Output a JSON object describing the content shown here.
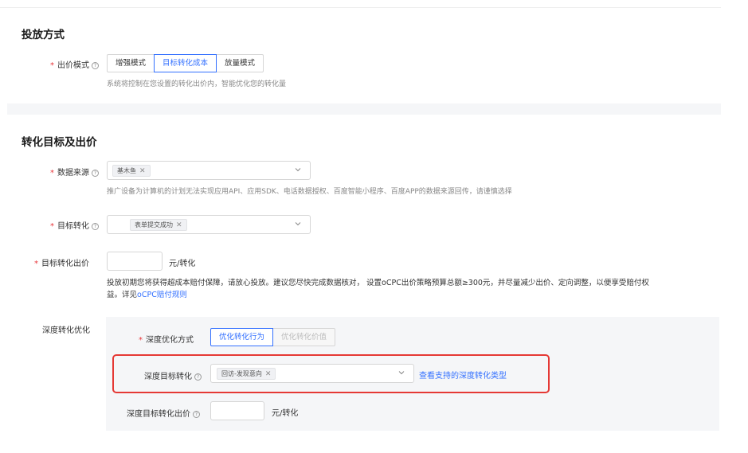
{
  "section1": {
    "title": "投放方式",
    "bid_mode_label": "出价模式",
    "modes": [
      "增强模式",
      "目标转化成本",
      "放量模式"
    ],
    "active_mode": "目标转化成本",
    "hint": "系统将控制在您设置的转化出价内，智能优化您的转化量"
  },
  "section2": {
    "title": "转化目标及出价",
    "data_source_label": "数据来源",
    "data_source_tag": "基木鱼",
    "data_source_hint": "推广设备为计算机的计划无法实现应用API、应用SDK、电话数据授权、百度智能小程序、百度APP的数据来源回传，请谨慎选择",
    "target_conv_label": "目标转化",
    "target_conv_tag": "表单提交成功",
    "target_bid_label": "目标转化出价",
    "target_bid_value": "",
    "target_bid_unit": "元/转化",
    "notice_line1": "投放初期您将获得超成本赔付保障，请放心投放。建议您尽快完成数据核对， 设置oCPC出价策略预算总额≥300元，并尽量减少出价、定向调整，以便享受赔付权",
    "notice_line2_prefix": "益。详见",
    "notice_link": "oCPC赔付规则"
  },
  "deep": {
    "label": "深度转化优化",
    "method_label": "深度优化方式",
    "methods": [
      "优化转化行为",
      "优化转化价值"
    ],
    "active_method": "优化转化行为",
    "deep_target_label": "深度目标转化",
    "deep_target_tag": "回访-发现意向",
    "view_types_link": "查看支持的深度转化类型",
    "deep_bid_label": "深度目标转化出价",
    "deep_bid_value": "",
    "deep_bid_unit": "元/转化"
  },
  "colors": {
    "accent": "#3370ff",
    "required": "#e8363a",
    "highlight_border": "#e53935",
    "panel_bg": "#f5f6f8"
  }
}
